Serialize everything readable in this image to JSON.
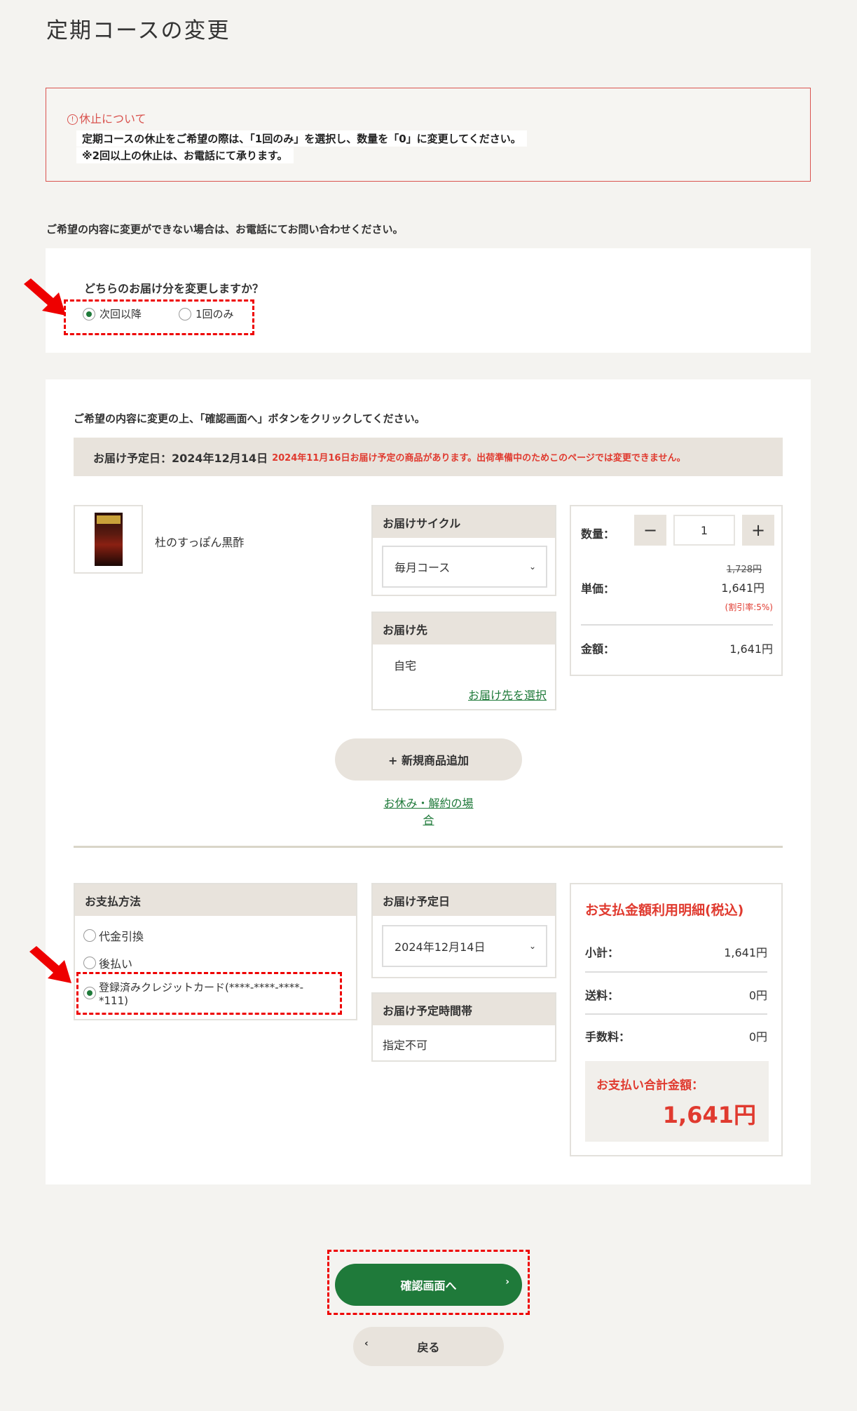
{
  "page_title": "定期コースの変更",
  "notice": {
    "title": "休止について",
    "line1": "定期コースの休止をご希望の際は、「1回のみ」を選択し、数量を「0」に変更してください。",
    "line2": "※2回以上の休止は、お電話にて承ります。"
  },
  "contact_text": "ご希望の内容に変更ができない場合は、お電話にてお問い合わせください。",
  "target": {
    "question": "どちらのお届け分を変更しますか？",
    "options": [
      "次回以降",
      "1回のみ"
    ],
    "selected": "次回以降"
  },
  "instructions": "ご希望の内容に変更の上、「確認画面へ」ボタンをクリックしてください。",
  "delivery_bar": {
    "label": "お届け予定日：2024年12月14日",
    "warning": "2024年11月16日お届け予定の商品があります。出荷準備中のためこのページでは変更できません。"
  },
  "product": {
    "name": "杜のすっぽん黒酢",
    "image_text": "杜のすっぽん黒酢",
    "cycle_header": "お届けサイクル",
    "cycle_value": "毎月コース",
    "dest_header": "お届け先",
    "dest_value": "自宅",
    "dest_link": "お届け先を選択",
    "qty_label": "数量：",
    "qty_minus": "−",
    "qty_value": "1",
    "qty_plus": "+",
    "unit_label": "単価：",
    "original_price": "1,728円",
    "unit_price": "1,641円",
    "discount": "(割引率:5%)",
    "amount_label": "金額：",
    "amount": "1,641円"
  },
  "add_product": "+ 新規商品追加",
  "pause_link": "お休み・解約の場合",
  "payment": {
    "header": "お支払方法",
    "options": [
      "代金引換",
      "後払い",
      "登録済みクレジットカード(****-****-****-",
      "*111)"
    ],
    "selected_index": 2
  },
  "schedule": {
    "date_header": "お届け予定日",
    "date_value": "2024年12月14日",
    "time_header": "お届け予定時間帯",
    "time_value": "指定不可"
  },
  "summary": {
    "title": "お支払金額利用明細(税込)",
    "subtotal_label": "小計：",
    "subtotal": "1,641円",
    "shipping_label": "送料：",
    "shipping": "0円",
    "fee_label": "手数料：",
    "fee": "0円",
    "total_label": "お支払い合計金額：",
    "total": "1,641円"
  },
  "confirm_button": "確認画面へ",
  "back_button": "戻る",
  "colors": {
    "accent_green": "#1f7a3a",
    "alert_red": "#e03a2f",
    "highlight_red": "#e00"
  }
}
